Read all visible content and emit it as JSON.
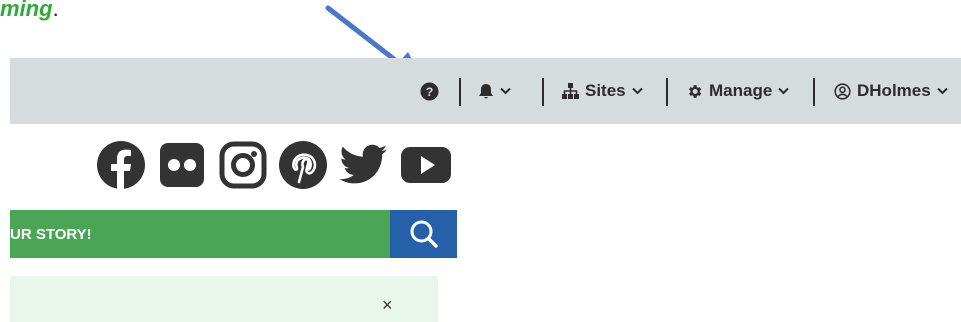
{
  "caption": {
    "text": "ming",
    "period": "."
  },
  "topbar": {
    "help_icon": "question-circle-icon",
    "notifications_icon": "bell-icon",
    "sites_label": "Sites",
    "manage_label": "Manage",
    "user_label": "DHolmes"
  },
  "social": {
    "icons": [
      "facebook-icon",
      "flickr-icon",
      "instagram-icon",
      "pinterest-icon",
      "twitter-icon",
      "youtube-icon"
    ]
  },
  "banner": {
    "text": "UR STORY!"
  },
  "alert": {
    "close_label": "×"
  },
  "colors": {
    "caption": "#2faa36",
    "topbar_bg": "#d6dcdd",
    "banner_green": "#4aa554",
    "search_blue": "#2660a8",
    "alert_bg": "#e8f6ec",
    "arrow_blue": "#4a78c8"
  }
}
